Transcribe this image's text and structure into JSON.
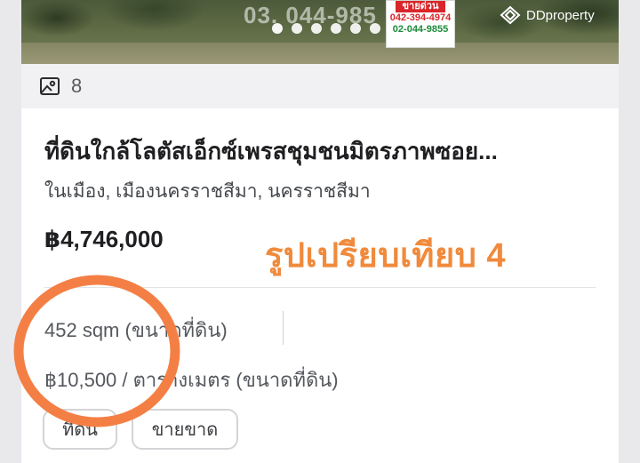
{
  "listing": {
    "photo_overlay_text": "03. 044-985",
    "sign_text": [
      "ขายด่วน",
      "042-394-4974",
      "02-044-9855"
    ],
    "brand": "DDproperty",
    "photo_count": "8",
    "title": "ที่ดินใกล้โลตัสเอ็กซ์เพรสชุมชนมิตรภาพซอย...",
    "location": "ในเมือง, เมืองนครราชสีมา, นครราชสีมา",
    "price": "฿4,746,000",
    "annotation": "รูปเปรียบเทียบ 4",
    "area": "452 sqm (ขนาดที่ดิน)",
    "price_per_sqm": "฿10,500 / ตารางเมตร (ขนาดที่ดิน)",
    "tags": [
      "ที่ดิน",
      "ขายขาด"
    ]
  },
  "carousel": {
    "dot_count": 6,
    "active_index": 0
  },
  "colors": {
    "annotation": "#f08a3c",
    "circle": "#f47f45",
    "text_primary": "#1f1f22",
    "text_secondary": "#55585d"
  },
  "icons": [
    "image-gallery-icon",
    "ddproperty-logo-icon"
  ]
}
